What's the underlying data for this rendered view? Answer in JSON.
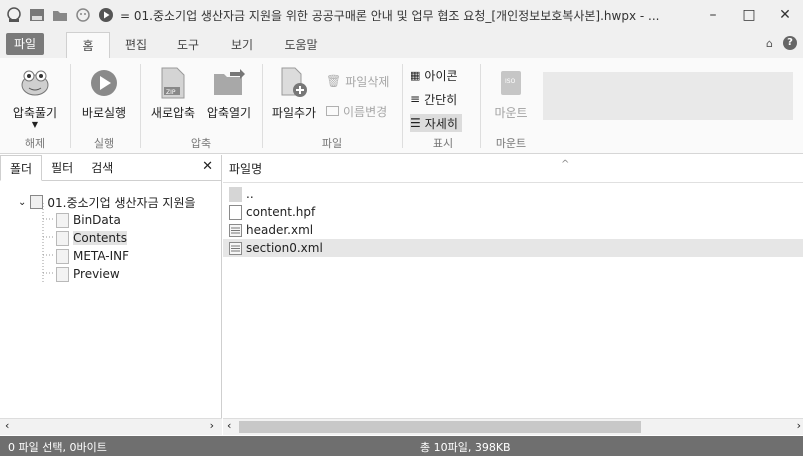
{
  "window": {
    "title": "= 01.중소기업 생산자금 지원을 위한 공공구매론 안내 및 업무 협조 요청_[개인정보보호복사본].hwpx - ...",
    "controls": {
      "minimize": "–",
      "maximize": "□",
      "close": "✕"
    }
  },
  "ribbon_tabs": [
    {
      "label": "파일"
    },
    {
      "label": "홈"
    },
    {
      "label": "편집"
    },
    {
      "label": "도구"
    },
    {
      "label": "보기"
    },
    {
      "label": "도움말"
    }
  ],
  "ribbon": {
    "extract": {
      "label": "압축풀기"
    },
    "run": {
      "label": "바로실행"
    },
    "new_archive": {
      "label": "새로압축"
    },
    "open_archive": {
      "label": "압축열기"
    },
    "add_file": {
      "label": "파일추가"
    },
    "delete_file": {
      "label": "파일삭제"
    },
    "rename": {
      "label": "이름변경"
    },
    "view_icons": {
      "label": "아이콘"
    },
    "view_simple": {
      "label": "간단히"
    },
    "view_detail": {
      "label": "자세히"
    },
    "mount": {
      "label": "마운트",
      "iso_text": "ISO"
    },
    "groups": {
      "extract": "해제",
      "run": "실행",
      "compress": "압축",
      "file": "파일",
      "display": "표시",
      "mount": "마운트"
    }
  },
  "left_panel": {
    "tabs": [
      {
        "label": "폴더"
      },
      {
        "label": "필터"
      },
      {
        "label": "검색"
      }
    ],
    "close": "✕",
    "tree": {
      "root": "01.중소기업 생산자금 지원을",
      "children": [
        "BinData",
        "Contents",
        "META-INF",
        "Preview"
      ],
      "selected": "Contents"
    }
  },
  "file_list": {
    "column": "파일명",
    "rows": [
      {
        "name": "..",
        "icon": "parent-folder-icon"
      },
      {
        "name": "content.hpf",
        "icon": "file-icon"
      },
      {
        "name": "header.xml",
        "icon": "xml-file-icon"
      },
      {
        "name": "section0.xml",
        "icon": "xml-file-icon"
      }
    ],
    "selected": "section0.xml"
  },
  "status": {
    "left": "0 파일 선택, 0바이트",
    "center": "총 10파일, 398KB"
  },
  "colors": {
    "status_bar": "#6f6f6f",
    "file_tab": "#7a7a7a",
    "selection": "#e2e2e2"
  }
}
